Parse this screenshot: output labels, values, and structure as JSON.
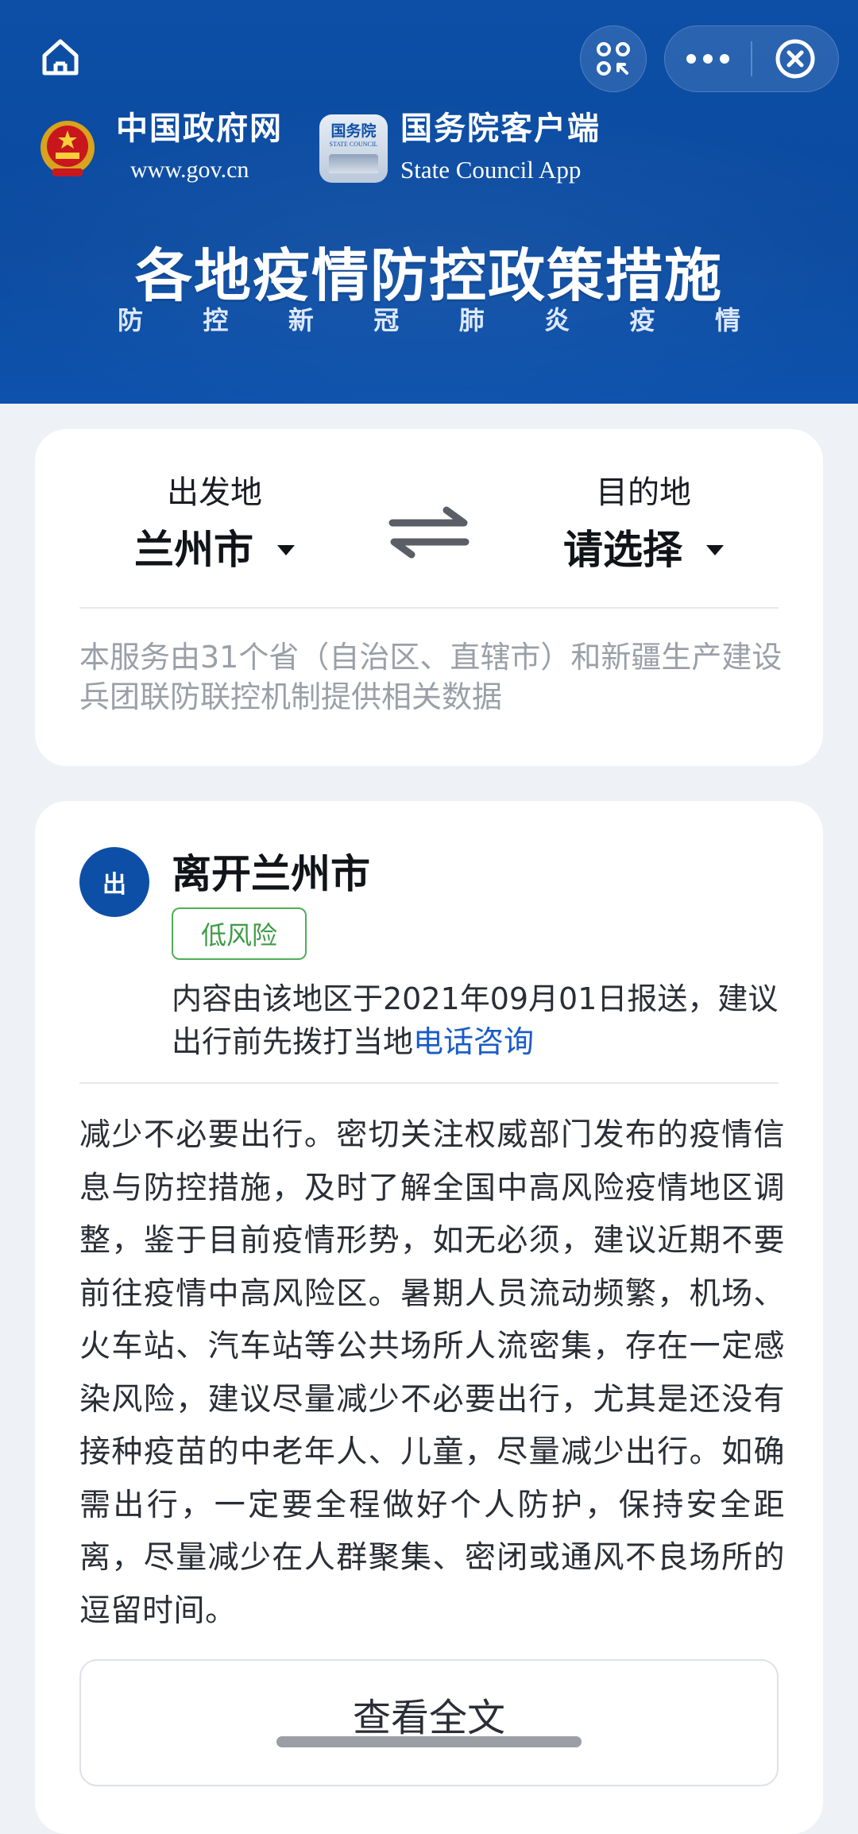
{
  "header": {
    "brand_gov_cn": "中国政府网",
    "brand_gov_en": "www.gov.cn",
    "brand_app_cn": "国务院客户端",
    "brand_app_en": "State Council App",
    "app_logo_text": "国务院",
    "app_logo_sub": "STATE COUNCIL",
    "headline": "各地疫情防控政策措施",
    "subline_chars": [
      "防",
      "控",
      "新",
      "冠",
      "肺",
      "炎",
      "疫",
      "情"
    ]
  },
  "route": {
    "from_label": "出发地",
    "from_value": "兰州市",
    "to_label": "目的地",
    "to_value": "请选择",
    "notice": "本服务由31个省（自治区、直辖市）和新疆生产建设兵团联防联控机制提供相关数据"
  },
  "leave": {
    "icon_label": "出",
    "title": "离开兰州市",
    "risk_level": "低风险",
    "report_text": "内容由该地区于2021年09月01日报送，建议出行前先拨打当地",
    "report_link": "电话咨询",
    "policy": "减少不必要出行。密切关注权威部门发布的疫情信息与防控措施，及时了解全国中高风险疫情地区调整，鉴于目前疫情形势，如无必须，建议近期不要前往疫情中高风险区。暑期人员流动频繁，机场、火车站、汽车站等公共场所人流密集，存在一定感染风险，建议尽量减少不必要出行，尤其是还没有接种疫苗的中老年人、儿童，尽量减少出行。如确需出行，一定要全程做好个人防护，保持安全距离，尽量减少在人群聚集、密闭或通风不良场所的逗留时间。",
    "view_full": "查看全文"
  },
  "colors": {
    "brand_blue": "#0d4fa6",
    "risk_green": "#3f9b47",
    "link_blue": "#1a5cc8"
  },
  "icons": {
    "home": "home-icon",
    "scan": "scan-icon",
    "more": "more-icon",
    "close": "close-circle-icon",
    "swap": "swap-arrows-icon",
    "dropdown": "caret-down-icon"
  }
}
